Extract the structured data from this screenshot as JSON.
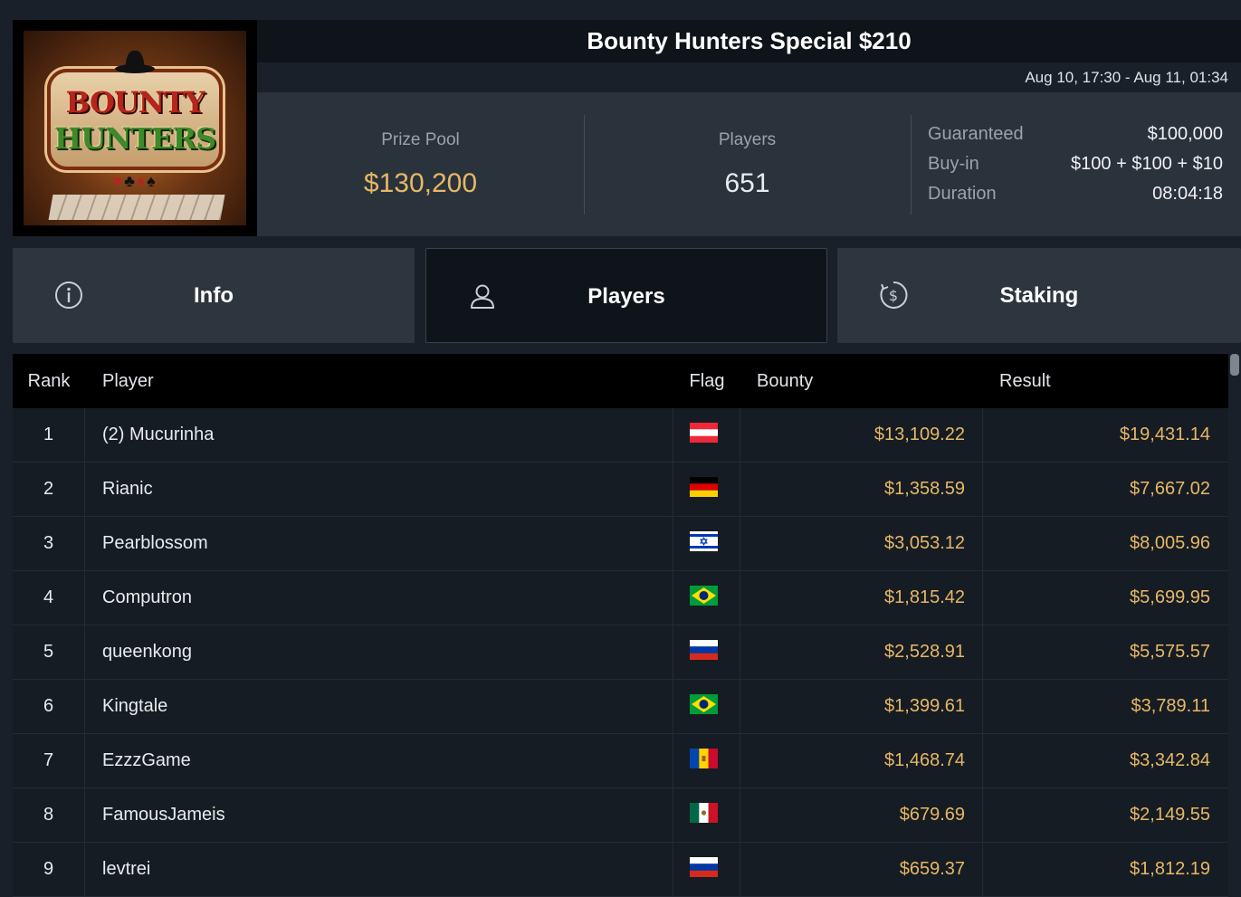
{
  "tournament": {
    "title": "Bounty Hunters Special $210",
    "dates": "Aug 10, 17:30 - Aug 11, 01:34",
    "logo": {
      "line1": "BOUNTY",
      "line2": "HUNTERS",
      "suits": "♥♣♦♠"
    }
  },
  "stats": {
    "prize_pool_label": "Prize Pool",
    "prize_pool_value": "$130,200",
    "players_label": "Players",
    "players_value": "651",
    "details": [
      {
        "key": "Guaranteed",
        "value": "$100,000"
      },
      {
        "key": "Buy-in",
        "value": "$100 + $100 + $10"
      },
      {
        "key": "Duration",
        "value": "08:04:18"
      }
    ]
  },
  "tabs": [
    {
      "label": "Info",
      "icon": "info-icon"
    },
    {
      "label": "Players",
      "icon": "user-icon"
    },
    {
      "label": "Staking",
      "icon": "dollar-cycle-icon"
    }
  ],
  "table": {
    "headers": {
      "rank": "Rank",
      "player": "Player",
      "flag": "Flag",
      "bounty": "Bounty",
      "result": "Result"
    },
    "rows": [
      {
        "rank": "1",
        "player": "(2) Mucurinha",
        "flag": "austria",
        "bounty": "$13,109.22",
        "result": "$19,431.14"
      },
      {
        "rank": "2",
        "player": "Rianic",
        "flag": "germany",
        "bounty": "$1,358.59",
        "result": "$7,667.02"
      },
      {
        "rank": "3",
        "player": "Pearblossom",
        "flag": "israel",
        "bounty": "$3,053.12",
        "result": "$8,005.96"
      },
      {
        "rank": "4",
        "player": "Computron",
        "flag": "brazil",
        "bounty": "$1,815.42",
        "result": "$5,699.95"
      },
      {
        "rank": "5",
        "player": "queenkong",
        "flag": "russia",
        "bounty": "$2,528.91",
        "result": "$5,575.57"
      },
      {
        "rank": "6",
        "player": "Kingtale",
        "flag": "brazil",
        "bounty": "$1,399.61",
        "result": "$3,789.11"
      },
      {
        "rank": "7",
        "player": "EzzzGame",
        "flag": "moldova",
        "bounty": "$1,468.74",
        "result": "$3,342.84"
      },
      {
        "rank": "8",
        "player": "FamousJameis",
        "flag": "mexico",
        "bounty": "$679.69",
        "result": "$2,149.55"
      },
      {
        "rank": "9",
        "player": "levtrei",
        "flag": "russia",
        "bounty": "$659.37",
        "result": "$1,812.19"
      }
    ]
  },
  "colors": {
    "accent_gold": "#e6b866",
    "background": "#192029",
    "panel": "#2a323c"
  }
}
